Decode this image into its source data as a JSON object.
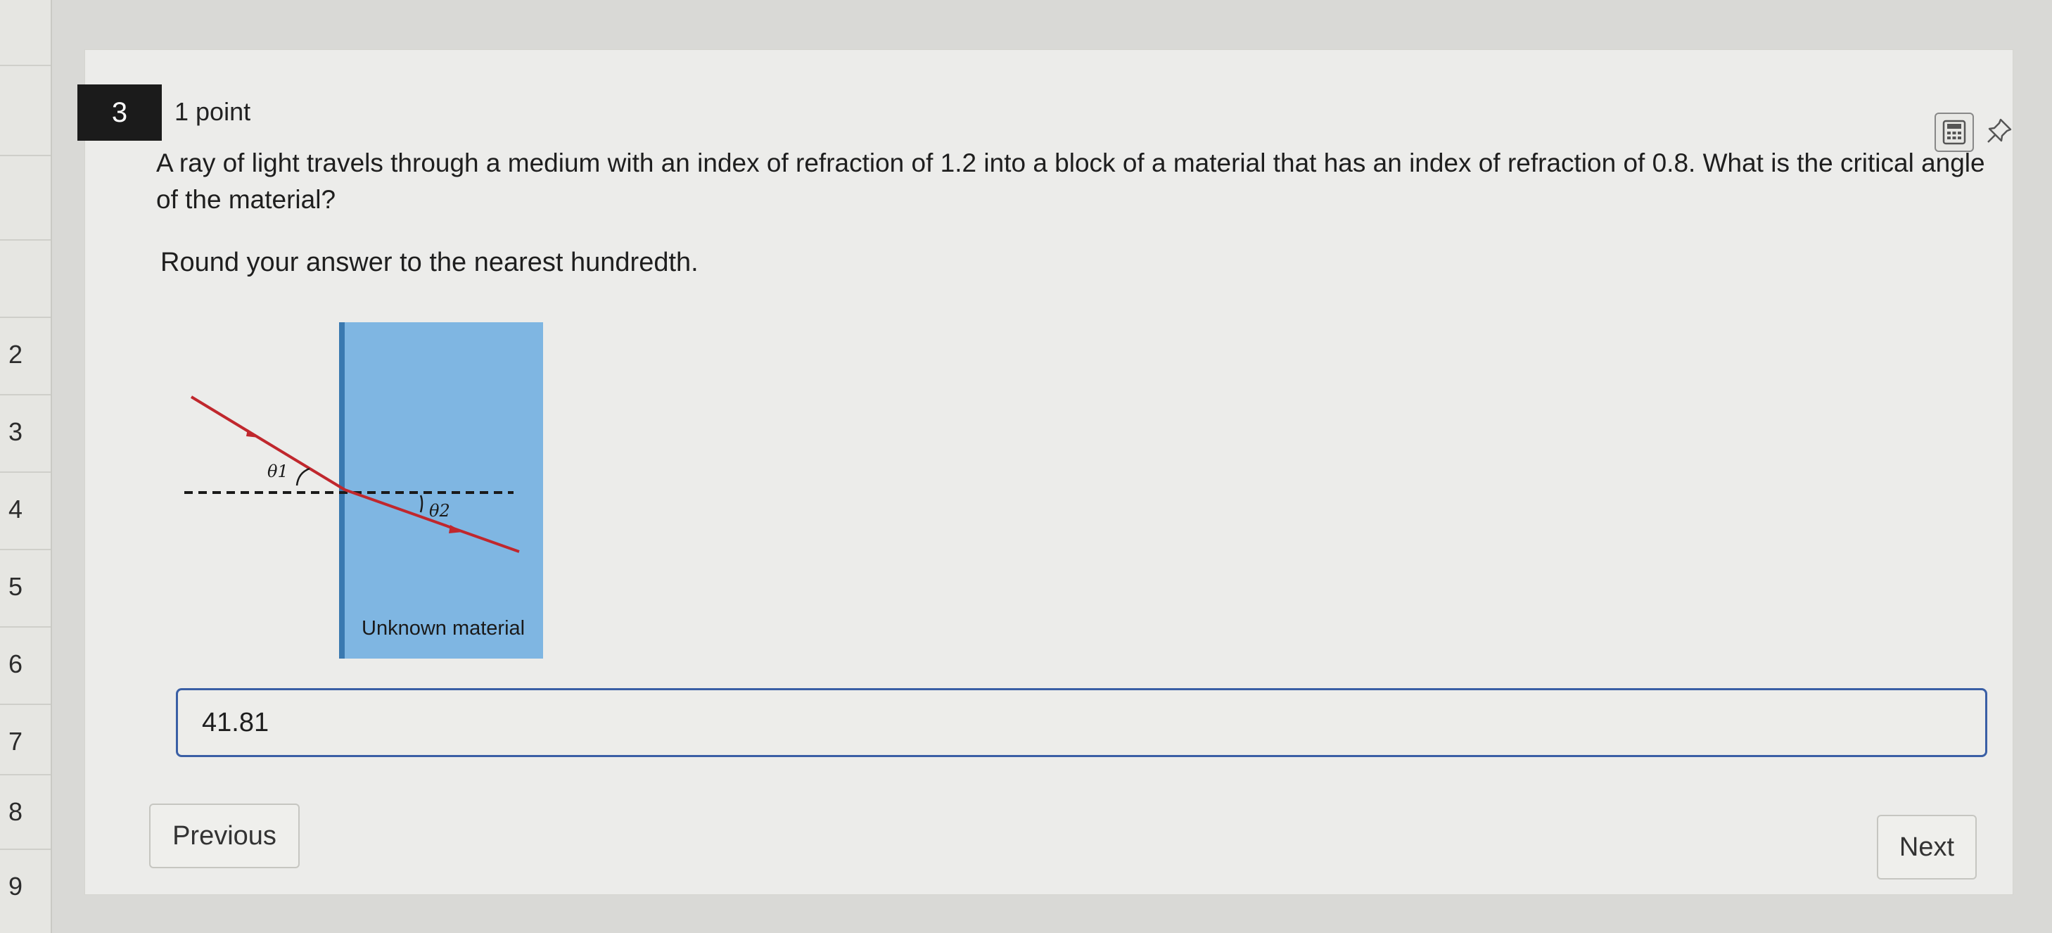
{
  "sidebar": {
    "items": [
      {
        "label": ""
      },
      {
        "label": ""
      },
      {
        "label": ""
      },
      {
        "label": "2"
      },
      {
        "label": "3"
      },
      {
        "label": "4"
      },
      {
        "label": "5"
      },
      {
        "label": "6"
      },
      {
        "label": "7"
      },
      {
        "label": "8"
      },
      {
        "label": "9"
      }
    ]
  },
  "question": {
    "number": "3",
    "points": "1 point",
    "text": "A ray of light travels through a medium with an index of refraction of 1.2 into a block of a material that has an index of refraction of 0.8. What is the critical angle of the material?",
    "instruction": "Round your answer to the nearest hundredth.",
    "figure": {
      "theta1_label": "θ1",
      "theta2_label": "θ2",
      "material_label": "Unknown material",
      "block_color": "#7fb6e2",
      "ray_color": "#c0272d"
    },
    "answer_value": "41.81"
  },
  "tools": {
    "calculator_icon": "calculator-icon",
    "pin_icon": "pin-icon"
  },
  "nav": {
    "previous_label": "Previous",
    "next_label": "Next"
  }
}
